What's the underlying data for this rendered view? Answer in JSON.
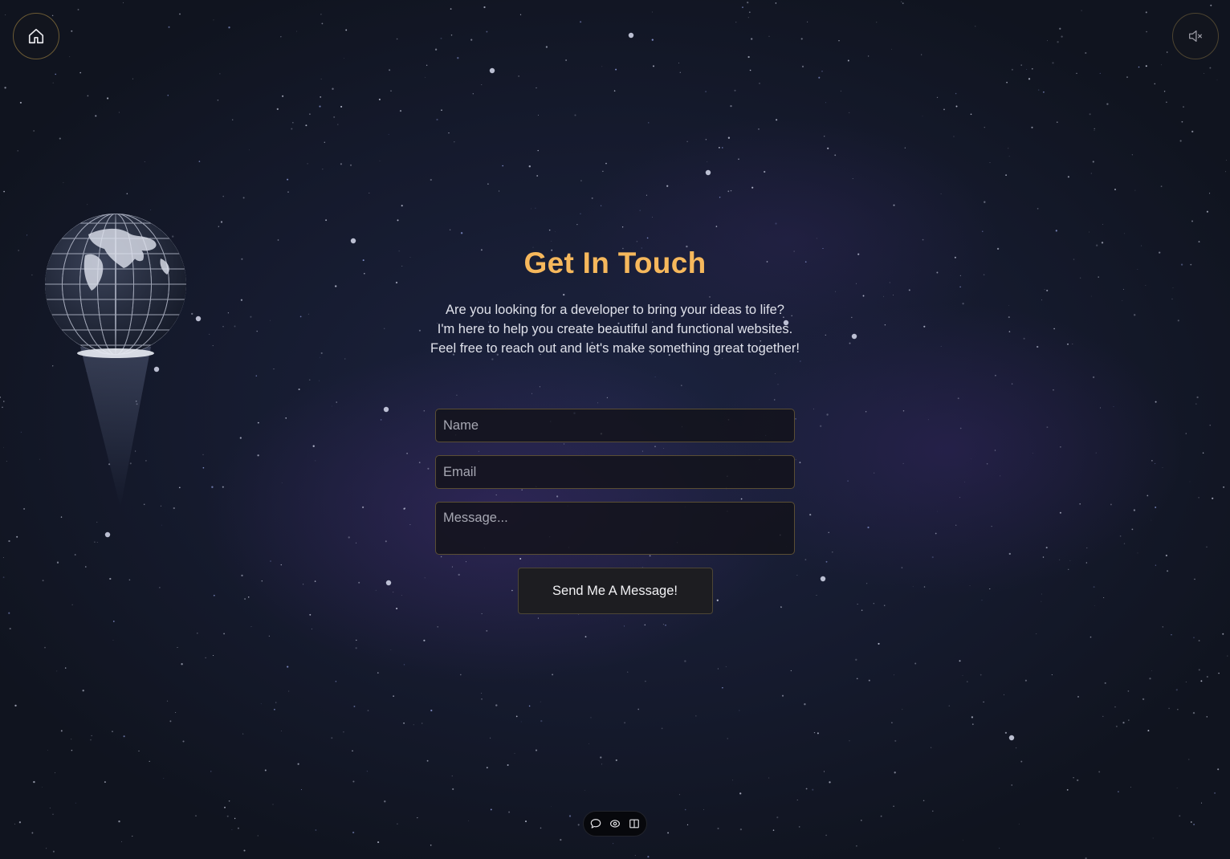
{
  "colors": {
    "title": "#f6b85c",
    "ring": "#6b5a34",
    "background": "#141a2c"
  },
  "header": {
    "home_icon": "home-icon",
    "mute_icon": "speaker-muted-icon"
  },
  "contact": {
    "title": "Get In Touch",
    "intro_lines": [
      "Are you looking for a developer to bring your ideas to life?",
      "I'm here to help you create beautiful and functional websites.",
      "Feel free to reach out and let's make something great together!"
    ],
    "form": {
      "name_placeholder": "Name",
      "email_placeholder": "Email",
      "message_placeholder": "Message...",
      "submit_label": "Send Me A Message!"
    }
  },
  "dock": {
    "items": [
      {
        "icon": "chat-bubble-icon"
      },
      {
        "icon": "eye-icon"
      },
      {
        "icon": "book-icon"
      }
    ]
  }
}
